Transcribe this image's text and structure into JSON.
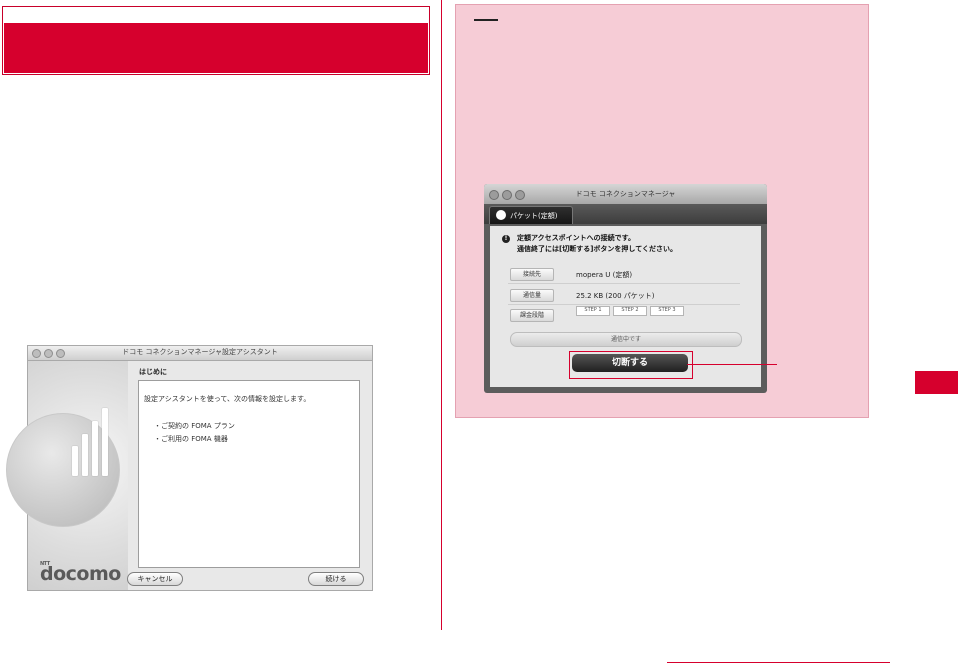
{
  "left_column": {
    "setup_assistant": {
      "window_title": "ドコモ コネクションマネージャ設定アシスタント",
      "heading": "はじめに",
      "intro": "設定アシスタントを使って、次の情報を設定します。",
      "items": [
        "・ご契約の FOMA プラン",
        "・ご利用の FOMA 機器"
      ],
      "logo_small": "NTT",
      "logo_text": "docomo",
      "cancel_label": "キャンセル",
      "continue_label": "続ける"
    }
  },
  "note_box": {
    "connection_manager": {
      "window_title": "ドコモ コネクションマネージャ",
      "tab_label": "パケット(定額)",
      "message_lines": [
        "定額アクセスポイントへの接続です。",
        "通信終了には[切断する]ボタンを押してください。"
      ],
      "fields": [
        {
          "label": "接続先",
          "value": "mopera U (定額)"
        },
        {
          "label": "通信量",
          "value": "25.2 KB (200 パケット)"
        },
        {
          "label": "課金段階",
          "value": ""
        }
      ],
      "stage_labels": [
        "STEP 1",
        "STEP 2",
        "STEP 3"
      ],
      "status_text": "通信中です",
      "disconnect_label": "切断する"
    }
  },
  "colors": {
    "accent": "#d6002d",
    "note_background": "#f6ccd6"
  }
}
